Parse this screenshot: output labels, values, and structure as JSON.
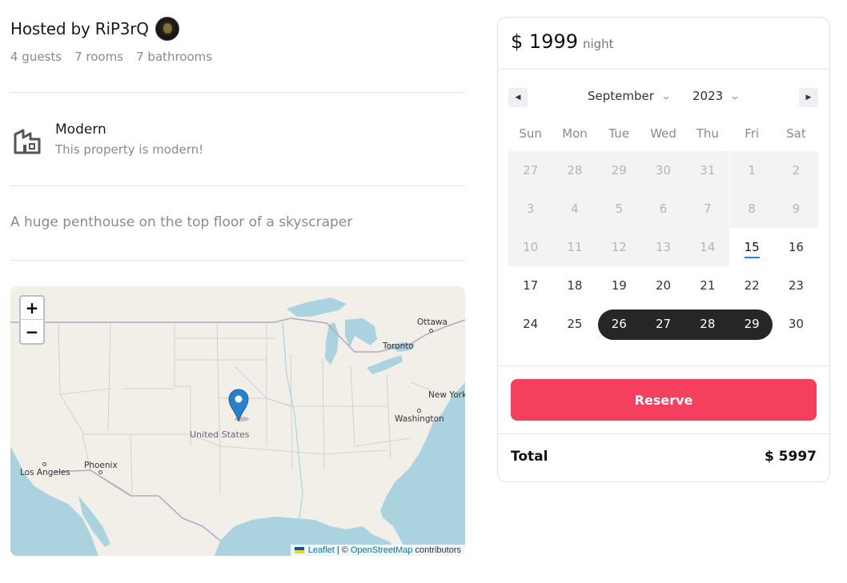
{
  "host": {
    "title": "Hosted by RiP3rQ",
    "guests": "4 guests",
    "rooms": "7 rooms",
    "bathrooms": "7 bathrooms"
  },
  "category": {
    "icon": "building-icon",
    "label": "Modern",
    "description": "This property is modern!"
  },
  "description": "A huge penthouse on the top floor of a skyscraper",
  "map": {
    "zoom_in": "+",
    "zoom_out": "−",
    "labels": {
      "ottawa": "Ottawa",
      "toronto": "Toronto",
      "new_york": "New York",
      "washington": "Washington",
      "united_states": "United States",
      "phoenix": "Phoenix",
      "los_angeles": "Los Angeles"
    },
    "attribution": {
      "leaflet": "Leaflet",
      "separator": "| ©",
      "osm": "OpenStreetMap",
      "suffix": "contributors"
    }
  },
  "booking": {
    "price": "$ 1999",
    "price_unit": "night",
    "calendar": {
      "prev_icon": "◀",
      "next_icon": "▶",
      "month": "September",
      "year": "2023",
      "weekdays": [
        "Sun",
        "Mon",
        "Tue",
        "Wed",
        "Thu",
        "Fri",
        "Sat"
      ],
      "weeks": [
        [
          "27",
          "28",
          "29",
          "30",
          "31",
          "1",
          "2"
        ],
        [
          "3",
          "4",
          "5",
          "6",
          "7",
          "8",
          "9"
        ],
        [
          "10",
          "11",
          "12",
          "13",
          "14",
          "15",
          "16"
        ],
        [
          "17",
          "18",
          "19",
          "20",
          "21",
          "22",
          "23"
        ],
        [
          "24",
          "25",
          "26",
          "27",
          "28",
          "29",
          "30"
        ]
      ],
      "today": "15",
      "selected_range": [
        "26",
        "29"
      ]
    },
    "reserve_label": "Reserve",
    "total_label": "Total",
    "total_value": "$ 5997"
  },
  "colors": {
    "accent": "#f43f5e",
    "selected_range": "#262626",
    "today_underline": "#2b7de9",
    "map_water": "#aad3df",
    "map_land": "#f2efe9",
    "marker": "#2a81cb"
  }
}
